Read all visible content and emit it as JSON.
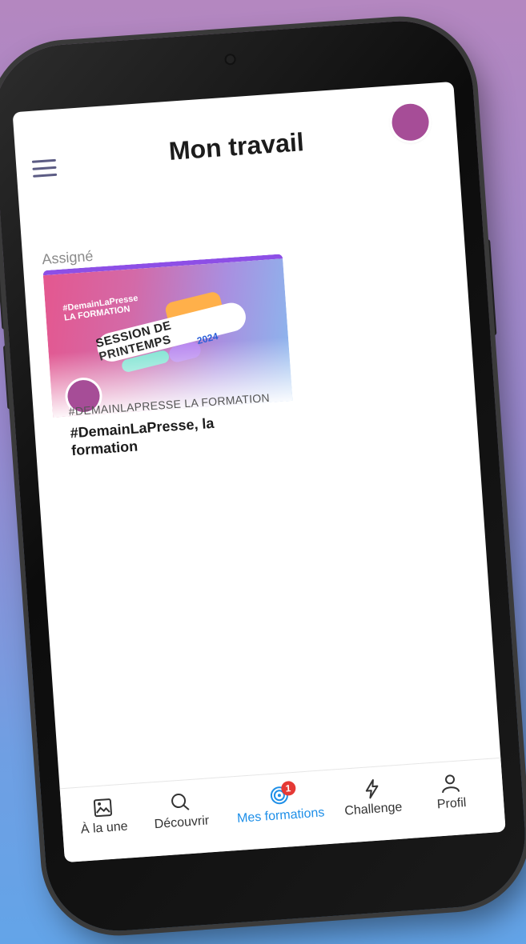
{
  "header": {
    "title": "Mon travail"
  },
  "section": {
    "label": "Assigné"
  },
  "card": {
    "brand": "#DemainLaPresse\nLA FORMATION",
    "banner_title": "SESSION DE PRINTEMPS",
    "banner_year": "2024",
    "category": "#DEMAINLAPRESSE LA FORMATION",
    "title": "#DemainLaPresse, la formation"
  },
  "tabbar": {
    "items": [
      {
        "label": "À la une",
        "icon": "image-icon",
        "active": false
      },
      {
        "label": "Découvrir",
        "icon": "search-icon",
        "active": false
      },
      {
        "label": "Mes formations",
        "icon": "target-icon",
        "active": true,
        "badge": "1"
      },
      {
        "label": "Challenge",
        "icon": "lightning-icon",
        "active": false
      },
      {
        "label": "Profil",
        "icon": "person-icon",
        "active": false
      }
    ]
  },
  "colors": {
    "accent": "#1e8fe8",
    "avatar": "#a64d97",
    "badge": "#e53935",
    "card_top_border": "#8d4fe6"
  }
}
